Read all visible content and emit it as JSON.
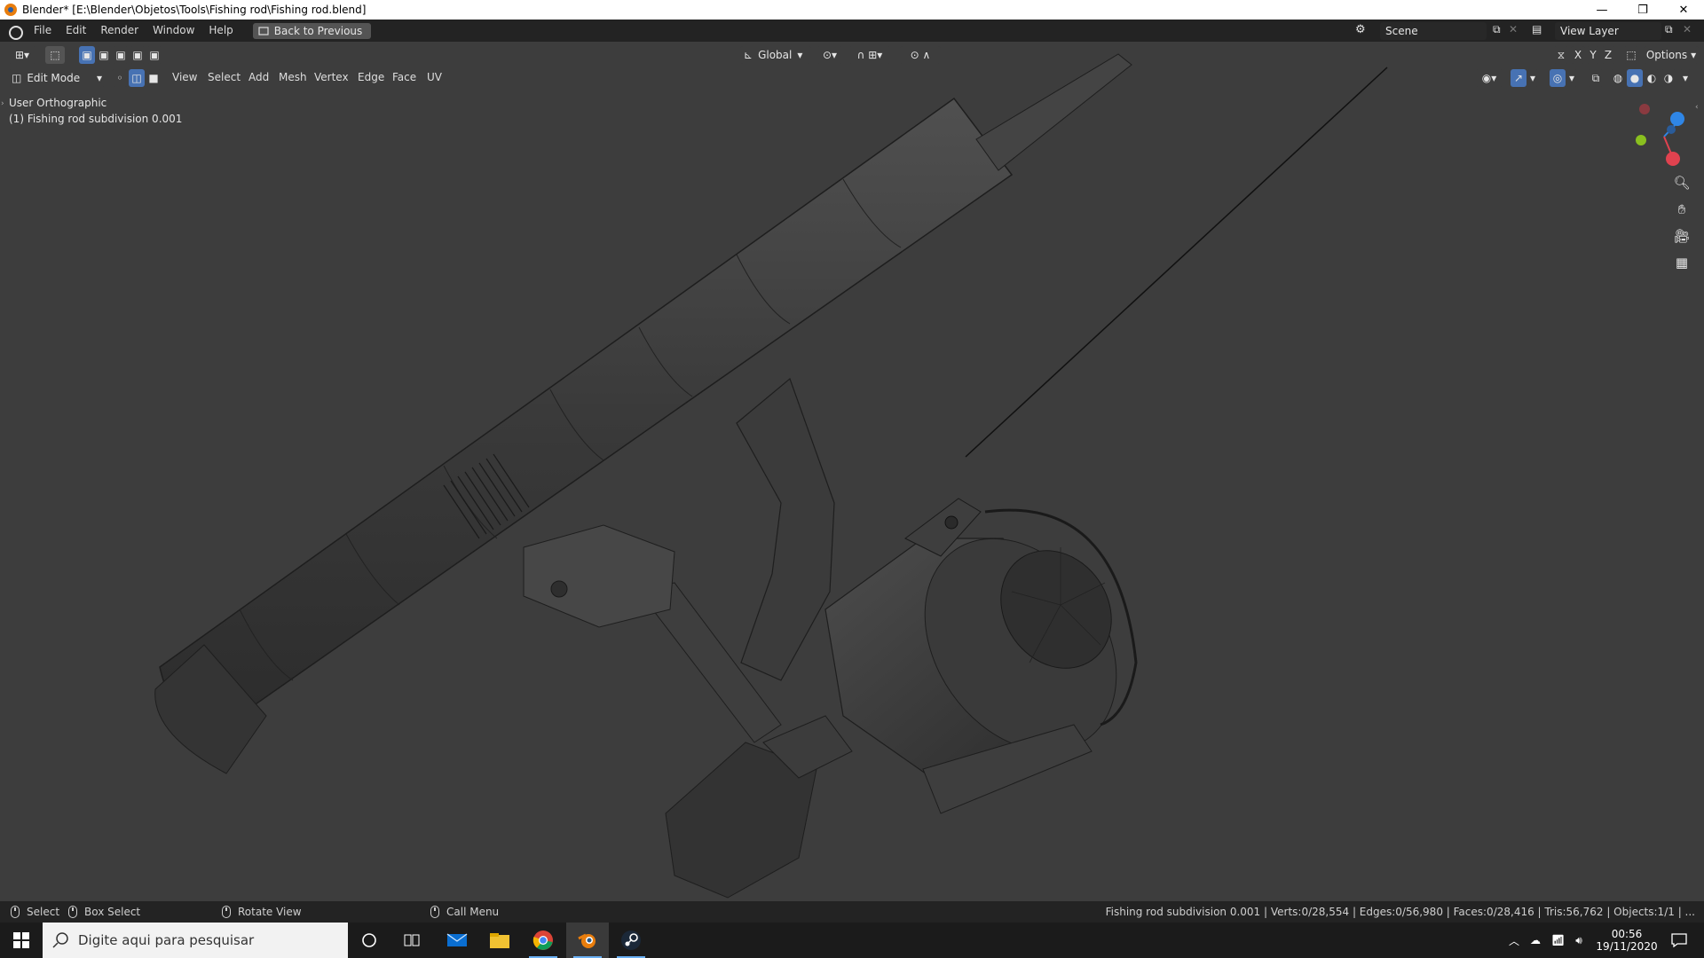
{
  "window": {
    "title": "Blender* [E:\\Blender\\Objetos\\Tools\\Fishing rod\\Fishing rod.blend]",
    "minimize": "—",
    "restore": "❐",
    "close": "✕"
  },
  "menubar": {
    "items": [
      "File",
      "Edit",
      "Render",
      "Window",
      "Help"
    ],
    "back_button": "Back to Previous",
    "scene_label": "Scene",
    "view_layer_label": "View Layer"
  },
  "viewport_header": {
    "mode": "Edit Mode",
    "menus": [
      "View",
      "Select",
      "Add",
      "Mesh",
      "Vertex",
      "Edge",
      "Face",
      "UV"
    ],
    "transform_orientation": "Global",
    "options_label": "Options",
    "axes": [
      "X",
      "Y",
      "Z"
    ]
  },
  "viewport": {
    "view_name": "User Orthographic",
    "object_name": "(1) Fishing rod subdivision 0.001",
    "gizmo": {
      "x_color": "#e0424f",
      "y_color": "#8ac01f",
      "z_color": "#2f86e6"
    }
  },
  "statusbar": {
    "select": "Select",
    "box_select": "Box Select",
    "rotate_view": "Rotate View",
    "call_menu": "Call Menu",
    "stats": "Fishing rod subdivision 0.001 | Verts:0/28,554 | Edges:0/56,980 | Faces:0/28,416 | Tris:56,762 | Objects:1/1 | ..."
  },
  "taskbar": {
    "search_placeholder": "Digite aqui para pesquisar",
    "time": "00:56",
    "date": "19/11/2020",
    "apps": [
      "cortana-icon",
      "task-view-icon",
      "mail-icon",
      "file-explorer-icon",
      "chrome-icon",
      "blender-icon",
      "steam-icon"
    ]
  }
}
